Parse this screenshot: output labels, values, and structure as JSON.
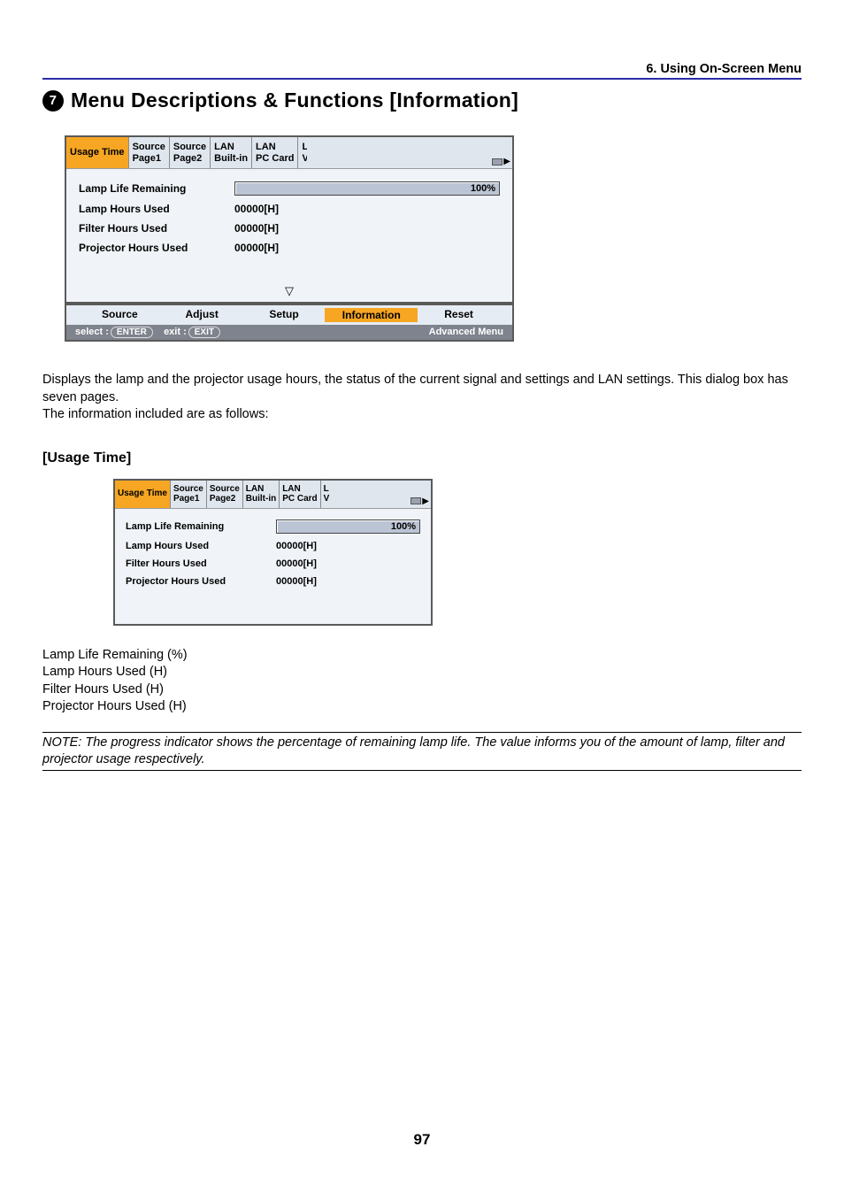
{
  "header": "6. Using On-Screen Menu",
  "section_num": "7",
  "heading": "Menu Descriptions & Functions [Information]",
  "tabs": {
    "usage_time": "Usage Time",
    "src1_a": "Source",
    "src1_b": "Page1",
    "src2_a": "Source",
    "src2_b": "Page2",
    "lanb_a": "LAN",
    "lanb_b": "Built-in",
    "lanp_a": "LAN",
    "lanp_b": "PC Card",
    "cut_a": "L",
    "cut_b": "V"
  },
  "rows": {
    "lamp_life": "Lamp Life Remaining",
    "lamp_hours": "Lamp Hours Used",
    "filter_hours": "Filter Hours Used",
    "proj_hours": "Projector Hours Used"
  },
  "vals": {
    "pct": "100%",
    "zero": "00000[H]"
  },
  "menubar": {
    "source": "Source",
    "adjust": "Adjust",
    "setup": "Setup",
    "info": "Information",
    "reset": "Reset",
    "select": "select :",
    "enter": "ENTER",
    "exit_lbl": "exit :",
    "exit_key": "EXIT",
    "adv": "Advanced Menu"
  },
  "para1": "Displays the lamp and the projector usage hours, the status of the current signal and settings and LAN settings. This dialog box has seven pages.",
  "para2": "The information included are as follows:",
  "subheading": "[Usage Time]",
  "list": {
    "l1": "Lamp Life Remaining (%)",
    "l2": "Lamp Hours Used (H)",
    "l3": "Filter Hours Used (H)",
    "l4": "Projector Hours Used (H)"
  },
  "note": "NOTE: The progress indicator shows the percentage of remaining lamp life. The value informs you of the amount of lamp, filter and projector usage respectively.",
  "page_num": "97"
}
